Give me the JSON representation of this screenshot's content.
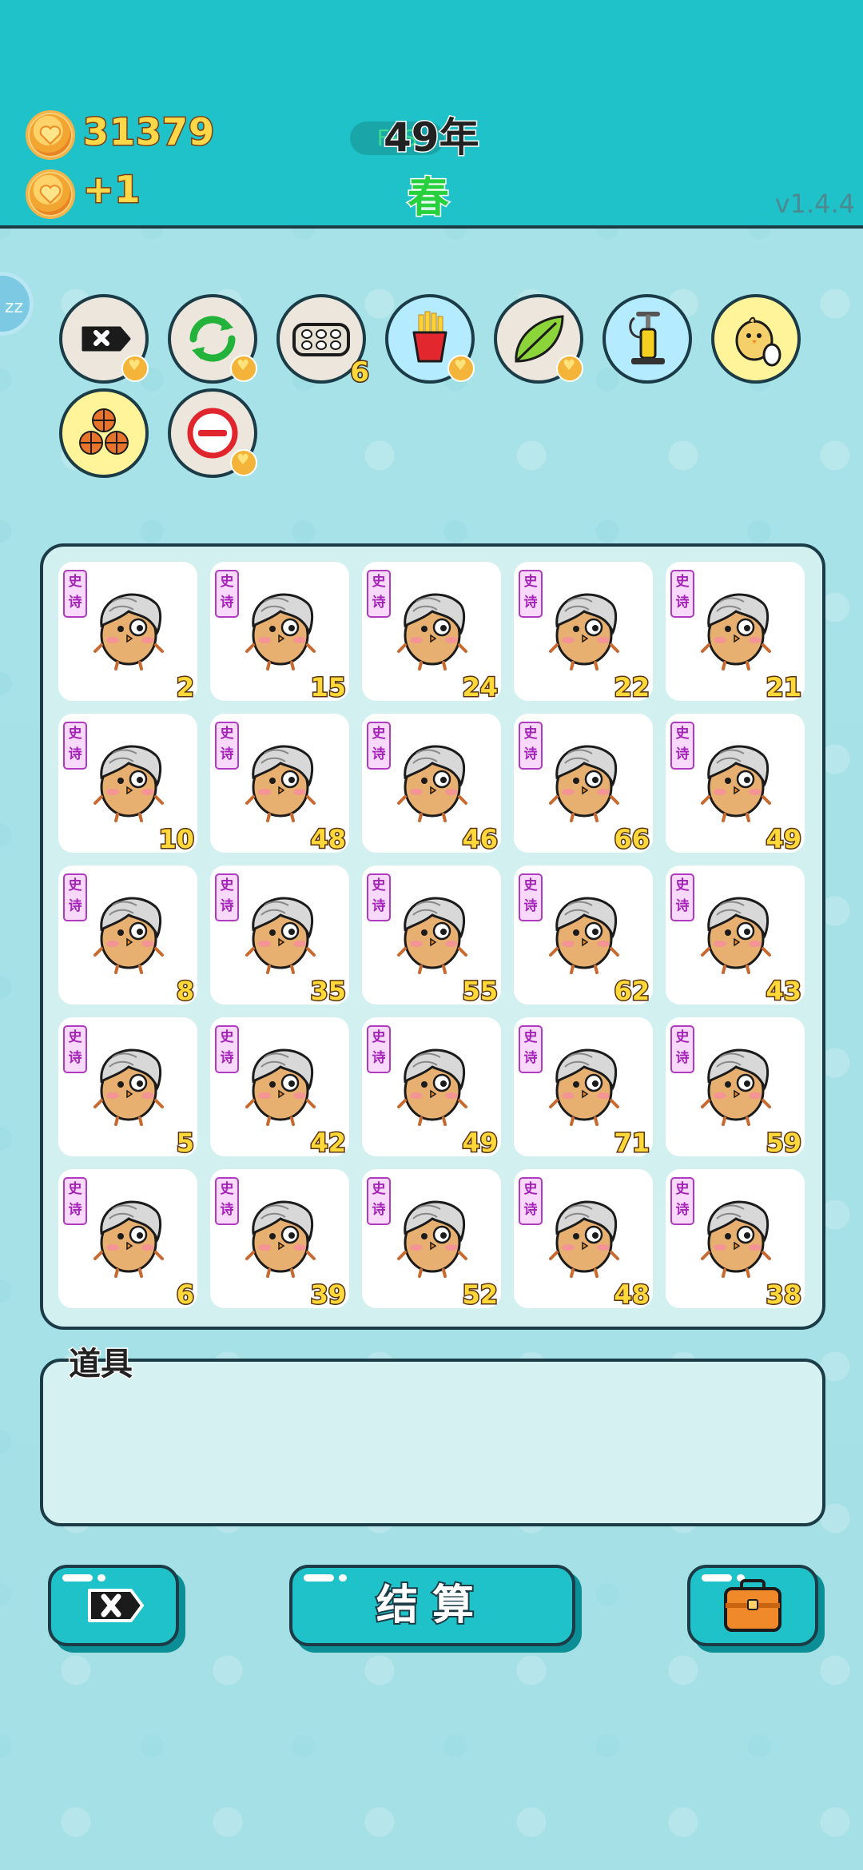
{
  "header": {
    "coins": "31379",
    "coin_income": "+1",
    "fps_label": "FPS",
    "year": "49年",
    "season": "春",
    "version": "v1.4.4"
  },
  "sleep_badge": "zz",
  "tools": [
    {
      "name": "delete-tag-tool",
      "icon": "delete-tag-icon"
    },
    {
      "name": "refresh-tool",
      "icon": "refresh-icon"
    },
    {
      "name": "egg-tray-tool",
      "icon": "egg-tray-icon",
      "count": "6"
    },
    {
      "name": "fries-tool",
      "icon": "fries-icon"
    },
    {
      "name": "leaf-tool",
      "icon": "leaf-icon"
    },
    {
      "name": "pump-tool",
      "icon": "pump-icon"
    },
    {
      "name": "chick-egg-tool",
      "icon": "chick-egg-icon"
    },
    {
      "name": "basketballs-tool",
      "icon": "basketballs-icon"
    },
    {
      "name": "minus-tool",
      "icon": "minus-circle-icon"
    }
  ],
  "grid": {
    "tag_text": "史诗",
    "cells": [
      [
        2,
        15,
        24,
        22,
        21
      ],
      [
        10,
        48,
        46,
        66,
        49
      ],
      [
        8,
        35,
        55,
        62,
        43
      ],
      [
        5,
        42,
        49,
        71,
        59
      ],
      [
        6,
        39,
        52,
        48,
        38
      ]
    ]
  },
  "items": {
    "label": "道具"
  },
  "buttons": {
    "settle_label": "结算"
  },
  "colors": {
    "topbar": "#1fc2c9",
    "background": "#a9e3e8",
    "outline": "#1b3c46",
    "value_text": "#ffd83a",
    "epic_tag": "#b03bc0"
  }
}
